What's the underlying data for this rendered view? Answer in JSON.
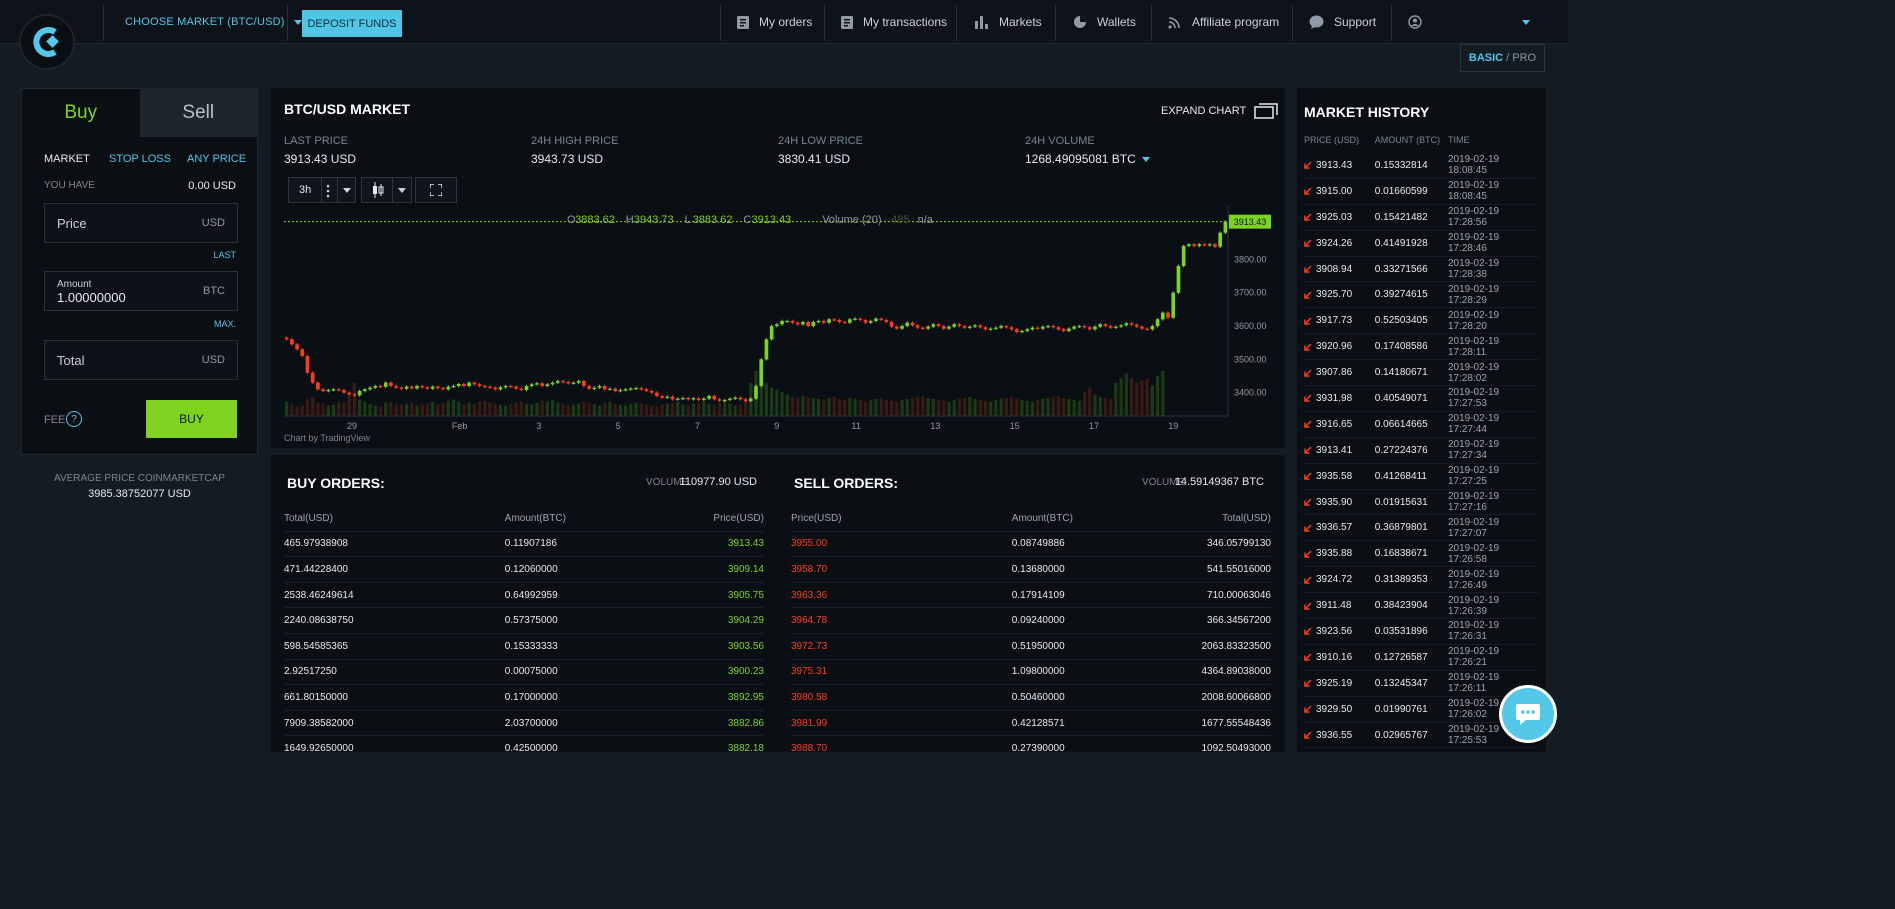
{
  "header": {
    "market_label": "CHOOSE MARKET (BTC/USD)",
    "deposit_label": "DEPOSIT FUNDS",
    "nav": [
      "My orders",
      "My transactions",
      "Markets",
      "Wallets",
      "Affiliate program",
      "Support"
    ],
    "mode_basic": "BASIC",
    "mode_sep": " / ",
    "mode_pro": "PRO"
  },
  "trade": {
    "tab_buy": "Buy",
    "tab_sell": "Sell",
    "type_market": "MARKET",
    "type_stop": "STOP LOSS",
    "type_any": "ANY PRICE",
    "you_have_label": "YOU HAVE",
    "you_have_value": "0.00 USD",
    "price_label": "Price",
    "price_unit": "USD",
    "last_link": "LAST",
    "amount_label": "Amount",
    "amount_value": "1.00000000",
    "amount_unit": "BTC",
    "max_link": "MAX.",
    "total_label": "Total",
    "total_unit": "USD",
    "fee_label": "FEE",
    "buy_button": "BUY",
    "avg_label": "AVERAGE PRICE COINMARKETCAP",
    "avg_value": "3985.38752077 USD"
  },
  "market": {
    "title": "BTC/USD MARKET",
    "expand_label": "EXPAND CHART",
    "last_price_label": "LAST PRICE",
    "last_price": "3913.43 USD",
    "high_label": "24H HIGH PRICE",
    "high": "3943.73 USD",
    "low_label": "24H LOW PRICE",
    "low": "3830.41 USD",
    "volume_label": "24H VOLUME",
    "volume": "1268.49095081 BTC",
    "interval": "3h",
    "credit": "Chart by TradingView"
  },
  "chart_data": {
    "type": "candlestick",
    "legend_o": "O",
    "legend_o_val": "3883.62",
    "legend_h": "H",
    "legend_h_val": "3943.73",
    "legend_l": "L",
    "legend_l_val": "3883.62",
    "legend_c": "C",
    "legend_c_val": "3913.43",
    "legend_volume": "Volume (20)",
    "legend_volume_val": "485",
    "legend_na": "n/a",
    "last_price_tag": "3913.43",
    "ylim": [
      3330,
      3960
    ],
    "y_ticks": [
      "3800.00",
      "3700.00",
      "3600.00",
      "3500.00",
      "3400.00"
    ],
    "y_tick_values": [
      3800,
      3700,
      3600,
      3500,
      3400
    ],
    "x_ticks": [
      "29",
      "Feb",
      "3",
      "5",
      "7",
      "9",
      "11",
      "13",
      "15",
      "17",
      "19"
    ],
    "close": [
      3560,
      3545,
      3530,
      3510,
      3460,
      3430,
      3410,
      3405,
      3408,
      3410,
      3408,
      3400,
      3395,
      3392,
      3405,
      3410,
      3415,
      3420,
      3418,
      3430,
      3420,
      3415,
      3412,
      3418,
      3413,
      3420,
      3416,
      3412,
      3418,
      3414,
      3410,
      3418,
      3420,
      3426,
      3420,
      3430,
      3425,
      3420,
      3418,
      3415,
      3410,
      3416,
      3420,
      3418,
      3412,
      3408,
      3420,
      3425,
      3428,
      3420,
      3425,
      3430,
      3435,
      3432,
      3428,
      3430,
      3435,
      3420,
      3412,
      3415,
      3420,
      3410,
      3412,
      3405,
      3408,
      3410,
      3412,
      3414,
      3410,
      3405,
      3400,
      3390,
      3385,
      3388,
      3380,
      3382,
      3384,
      3380,
      3383,
      3378,
      3382,
      3390,
      3380,
      3376,
      3378,
      3382,
      3385,
      3380,
      3375,
      3382,
      3420,
      3500,
      3560,
      3600,
      3605,
      3615,
      3615,
      3610,
      3605,
      3612,
      3600,
      3612,
      3615,
      3610,
      3620,
      3618,
      3612,
      3610,
      3620,
      3622,
      3618,
      3610,
      3615,
      3622,
      3618,
      3612,
      3598,
      3592,
      3600,
      3610,
      3602,
      3595,
      3592,
      3598,
      3605,
      3600,
      3592,
      3598,
      3605,
      3600,
      3595,
      3598,
      3602,
      3596,
      3590,
      3592,
      3595,
      3600,
      3596,
      3590,
      3582,
      3585,
      3590,
      3595,
      3592,
      3598,
      3600,
      3596,
      3590,
      3585,
      3592,
      3598,
      3600,
      3596,
      3590,
      3598,
      3605,
      3600,
      3595,
      3598,
      3602,
      3608,
      3604,
      3598,
      3592,
      3590,
      3600,
      3620,
      3640,
      3625,
      3700,
      3780,
      3840,
      3845,
      3840,
      3845,
      3843,
      3845,
      3838,
      3880,
      3913
    ],
    "volume": [
      30,
      25,
      20,
      22,
      35,
      40,
      28,
      26,
      22,
      24,
      30,
      28,
      45,
      70,
      35,
      30,
      25,
      22,
      20,
      28,
      30,
      26,
      24,
      25,
      28,
      22,
      24,
      26,
      30,
      25,
      28,
      32,
      35,
      30,
      25,
      28,
      26,
      30,
      32,
      28,
      26,
      24,
      22,
      25,
      28,
      30,
      26,
      24,
      28,
      32,
      30,
      34,
      28,
      26,
      22,
      24,
      26,
      30,
      28,
      25,
      22,
      28,
      30,
      26,
      24,
      22,
      25,
      28,
      26,
      24,
      22,
      20,
      24,
      26,
      28,
      30,
      24,
      22,
      26,
      28,
      30,
      26,
      24,
      28,
      30,
      26,
      22,
      24,
      32,
      70,
      95,
      80,
      70,
      60,
      55,
      50,
      45,
      40,
      38,
      42,
      40,
      38,
      36,
      34,
      38,
      40,
      36,
      34,
      38,
      36,
      34,
      32,
      34,
      36,
      38,
      34,
      32,
      30,
      34,
      36,
      38,
      40,
      42,
      38,
      36,
      34,
      32,
      30,
      34,
      36,
      38,
      40,
      36,
      34,
      32,
      30,
      34,
      36,
      38,
      40,
      36,
      34,
      32,
      30,
      34,
      36,
      38,
      40,
      42,
      38,
      36,
      34,
      32,
      50,
      60,
      45,
      40,
      38,
      36,
      70,
      80,
      90,
      80,
      70,
      75,
      80,
      65,
      85,
      95
    ]
  },
  "buy_orders": {
    "title": "BUY ORDERS:",
    "volume_label": "VOLUME",
    "volume_value": "110977.90 USD",
    "headers": [
      "Total(USD)",
      "Amount(BTC)",
      "Price(USD)"
    ],
    "rows": [
      [
        "465.97938908",
        "0.11907186",
        "3913.43"
      ],
      [
        "471.44228400",
        "0.12060000",
        "3909.14"
      ],
      [
        "2538.46249614",
        "0.64992959",
        "3905.75"
      ],
      [
        "2240.08638750",
        "0.57375000",
        "3904.29"
      ],
      [
        "598.54585365",
        "0.15333333",
        "3903.56"
      ],
      [
        "2.92517250",
        "0.00075000",
        "3900.23"
      ],
      [
        "661.80150000",
        "0.17000000",
        "3892.95"
      ],
      [
        "7909.38582000",
        "2.03700000",
        "3882.86"
      ],
      [
        "1649.92650000",
        "0.42500000",
        "3882.18"
      ]
    ]
  },
  "sell_orders": {
    "title": "SELL ORDERS:",
    "volume_label": "VOLUME",
    "volume_value": "14.59149367 BTC",
    "headers": [
      "Price(USD)",
      "Amount(BTC)",
      "Total(USD)"
    ],
    "rows": [
      [
        "3955.00",
        "0.08749886",
        "346.05799130"
      ],
      [
        "3958.70",
        "0.13680000",
        "541.55016000"
      ],
      [
        "3963.36",
        "0.17914109",
        "710.00063046"
      ],
      [
        "3964.78",
        "0.09240000",
        "366.34567200"
      ],
      [
        "3972.73",
        "0.51950000",
        "2063.83323500"
      ],
      [
        "3975.31",
        "1.09800000",
        "4364.89038000"
      ],
      [
        "3980.58",
        "0.50460000",
        "2008.60066800"
      ],
      [
        "3981.99",
        "0.42128571",
        "1677.55548436"
      ],
      [
        "3988.70",
        "0.27390000",
        "1092.50493000"
      ]
    ]
  },
  "history": {
    "title": "MARKET HISTORY",
    "headers": [
      "PRICE (USD)",
      "AMOUNT (BTC)",
      "TIME"
    ],
    "rows": [
      [
        "3913.43",
        "0.15332814",
        "2019-02-19 18:08:45"
      ],
      [
        "3915.00",
        "0.01660599",
        "2019-02-19 18:08:45"
      ],
      [
        "3925.03",
        "0.15421482",
        "2019-02-19 17:28:56"
      ],
      [
        "3924.26",
        "0.41491928",
        "2019-02-19 17:28:46"
      ],
      [
        "3908.94",
        "0.33271566",
        "2019-02-19 17:28:38"
      ],
      [
        "3925.70",
        "0.39274615",
        "2019-02-19 17:28:29"
      ],
      [
        "3917.73",
        "0.52503405",
        "2019-02-19 17:28:20"
      ],
      [
        "3920.96",
        "0.17408586",
        "2019-02-19 17:28:11"
      ],
      [
        "3907.86",
        "0.14180671",
        "2019-02-19 17:28:02"
      ],
      [
        "3931.98",
        "0.40549071",
        "2019-02-19 17:27:53"
      ],
      [
        "3916.65",
        "0.06614665",
        "2019-02-19 17:27:44"
      ],
      [
        "3913.41",
        "0.27224376",
        "2019-02-19 17:27:34"
      ],
      [
        "3935.58",
        "0.41268411",
        "2019-02-19 17:27:25"
      ],
      [
        "3935.90",
        "0.01915631",
        "2019-02-19 17:27:16"
      ],
      [
        "3936.57",
        "0.36879801",
        "2019-02-19 17:27:07"
      ],
      [
        "3935.88",
        "0.16838671",
        "2019-02-19 17:26:58"
      ],
      [
        "3924.72",
        "0.31389353",
        "2019-02-19 17:26:49"
      ],
      [
        "3911.48",
        "0.38423904",
        "2019-02-19 17:26:39"
      ],
      [
        "3923.56",
        "0.03531896",
        "2019-02-19 17:26:31"
      ],
      [
        "3910.16",
        "0.12726587",
        "2019-02-19 17:26:21"
      ],
      [
        "3925.19",
        "0.13245347",
        "2019-02-19 17:26:11"
      ],
      [
        "3929.50",
        "0.01990761",
        "2019-02-19 17:26:02"
      ],
      [
        "3936.55",
        "0.02965767",
        "2019-02-19 17:25:53"
      ]
    ]
  },
  "colors": {
    "accent": "#53c6e8",
    "buy": "#7ed321",
    "sell": "#ff3b1f"
  }
}
